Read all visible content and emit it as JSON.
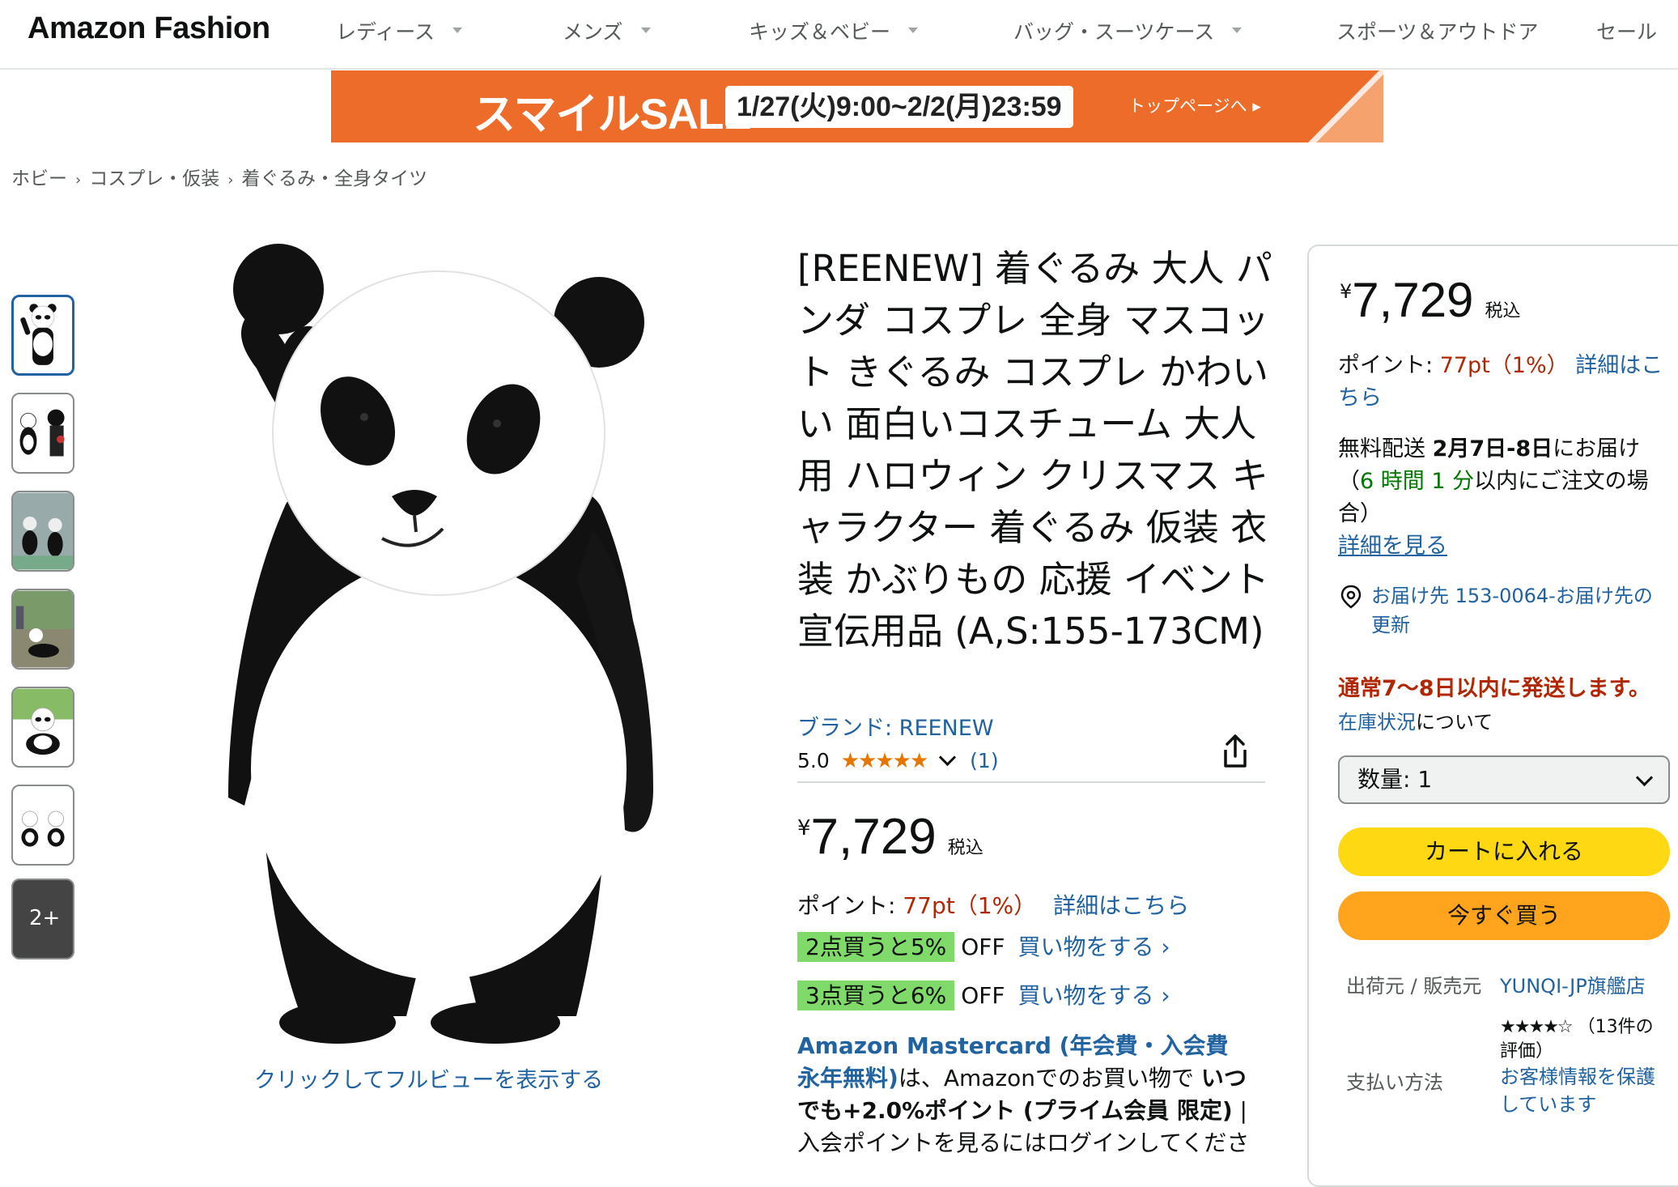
{
  "nav": {
    "logo": "Amazon Fashion",
    "items": [
      "レディース",
      "メンズ",
      "キッズ＆ベビー",
      "バッグ・スーツケース",
      "スポーツ＆アウトドア",
      "セール"
    ]
  },
  "banner": {
    "title": "スマイルSALE",
    "dates": "1/27(火)9:00~2/2(月)23:59",
    "link": "トップページへ ▸",
    "color": "#ee6c2a"
  },
  "breadcrumb": [
    "ホビー",
    "コスプレ・仮装",
    "着ぐるみ・全身タイツ"
  ],
  "gallery": {
    "more_label": "2+",
    "full_view": "クリックしてフルビューを表示する"
  },
  "product": {
    "title": "[REENEW] 着ぐるみ 大人 パンダ コスプレ 全身 マスコット きぐるみ コスプレ かわいい 面白いコスチューム 大人用 ハロウィン クリスマス キャラクター 着ぐるみ 仮装 衣装 かぶりもの 応援 イベント宣伝用品 (A,S:155-173CM)",
    "brand": "ブランド: REENEW",
    "rating_value": "5.0",
    "stars": "★★★★★",
    "rating_count": "(1)",
    "price_symbol": "¥",
    "price": "7,729",
    "tax_label": "税込",
    "points_label": "ポイント:",
    "points_value": "77pt（1%）",
    "points_link": "詳細はこちら",
    "deals": [
      {
        "tag": "2点買うと5%",
        "off": "OFF",
        "link": "買い物をする ›"
      },
      {
        "tag": "3点買うと6%",
        "off": "OFF",
        "link": "買い物をする ›"
      }
    ],
    "mastercard": {
      "bold": "Amazon Mastercard (年会費・入会費 永年無料)",
      "text1": "は、Amazonでのお買い物で ",
      "bold2": "いつでも+2.0%ポイント (プライム会員 限定)",
      "text2": " | 入会ポイントを見るにはログインしてくださ"
    }
  },
  "buybox": {
    "price_symbol": "¥",
    "price": "7,729",
    "tax_label": "税込",
    "points_label": "ポイント:",
    "points_value": "77pt（1%）",
    "points_link": "詳細はこちら",
    "delivery_prefix": "無料配送",
    "delivery_dates": "2月7日-8日",
    "delivery_suffix": "にお届け",
    "cutoff_open": "（",
    "cutoff_time": "6 時間 1 分",
    "cutoff_rest": "以内にご注文の場合）",
    "details_link": "詳細を見る",
    "location_text": "お届け先 153-0064-お届け先の更新",
    "ship_notice": "通常7〜8日以内に発送します。",
    "stock_link": "在庫状況",
    "stock_suffix": "について",
    "qty_label": "数量: 1",
    "add_to_cart": "カートに入れる",
    "buy_now": "今すぐ買う",
    "seller_label": "出荷元 / 販売元",
    "seller_name": "YUNQI-JP旗艦店",
    "seller_stars": "★★★★☆",
    "seller_reviews": "（13件の評価）",
    "payment_label": "支払い方法",
    "payment_value": "お客様情報を保護しています",
    "accent_cart": "#ffd814",
    "accent_buy": "#ffa41c"
  }
}
